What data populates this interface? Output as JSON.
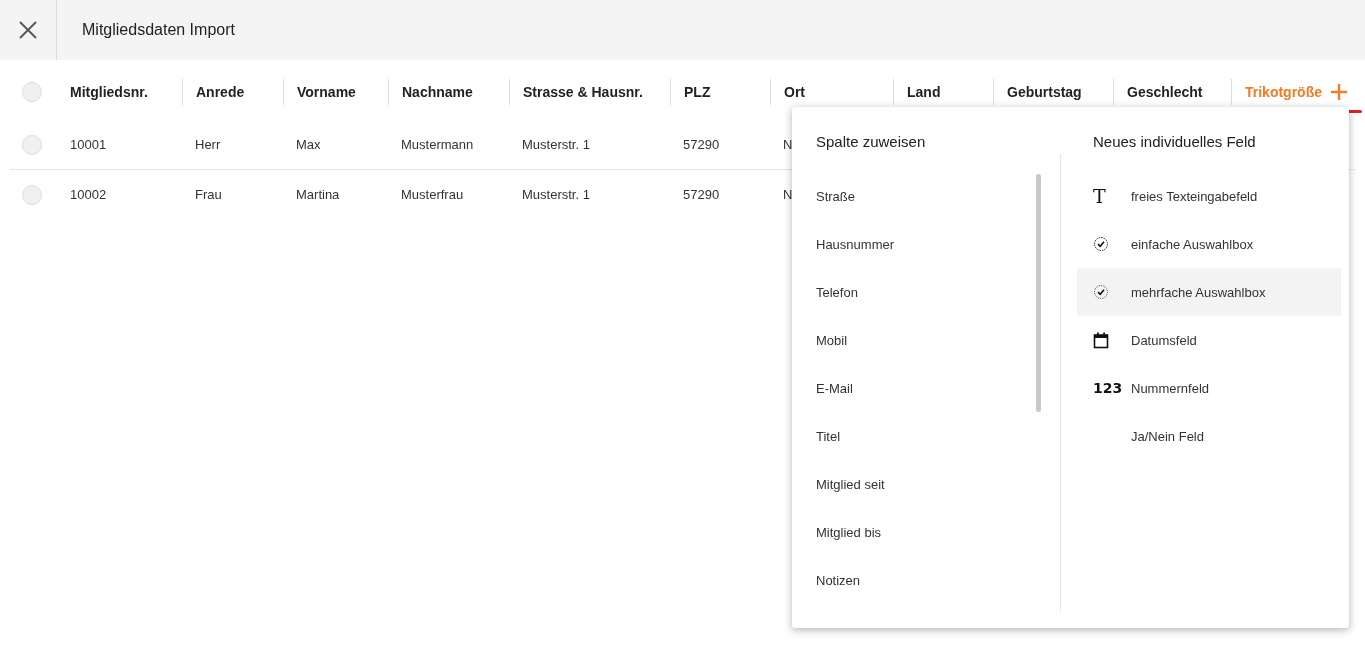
{
  "window": {
    "title": "Mitgliedsdaten Import"
  },
  "table": {
    "select_all": {
      "checked": false
    },
    "columns": [
      {
        "label": "Mitgliedsnr.",
        "selected": false
      },
      {
        "label": "Anrede",
        "selected": false
      },
      {
        "label": "Vorname",
        "selected": false
      },
      {
        "label": "Nachname",
        "selected": false
      },
      {
        "label": "Strasse & Hausnr.",
        "selected": false
      },
      {
        "label": "PLZ",
        "selected": false
      },
      {
        "label": "Ort",
        "selected": false
      },
      {
        "label": "Land",
        "selected": false
      },
      {
        "label": "Geburtstag",
        "selected": false
      },
      {
        "label": "Geschlecht",
        "selected": false
      },
      {
        "label": "Trikotgröße",
        "selected": true
      }
    ],
    "rows": [
      {
        "checked": false,
        "cells": [
          "10001",
          "Herr",
          "Max",
          "Mustermann",
          "Musterstr. 1",
          "57290",
          "N"
        ]
      },
      {
        "checked": false,
        "cells": [
          "10002",
          "Frau",
          "Martina",
          "Musterfrau",
          "Musterstr. 1",
          "57290",
          "N"
        ]
      }
    ]
  },
  "popup": {
    "assign": {
      "title": "Spalte zuweisen",
      "items": [
        "Straße",
        "Hausnummer",
        "Telefon",
        "Mobil",
        "E-Mail",
        "Titel",
        "Mitglied seit",
        "Mitglied bis",
        "Notizen"
      ]
    },
    "new_field": {
      "title": "Neues individuelles Feld",
      "items": [
        {
          "kind": "text",
          "glyph": "T",
          "label": "freies Texteingabefeld",
          "selected": false
        },
        {
          "kind": "single",
          "label": "einfache Auswahlbox",
          "selected": false
        },
        {
          "kind": "multi",
          "label": "mehrfache Auswahlbox",
          "selected": true
        },
        {
          "kind": "date",
          "label": "Datumsfeld",
          "selected": false
        },
        {
          "kind": "number",
          "glyph": "123",
          "label": "Nummernfeld",
          "selected": false
        },
        {
          "kind": "boolean",
          "label": "Ja/Nein Feld",
          "selected": false
        }
      ]
    }
  }
}
